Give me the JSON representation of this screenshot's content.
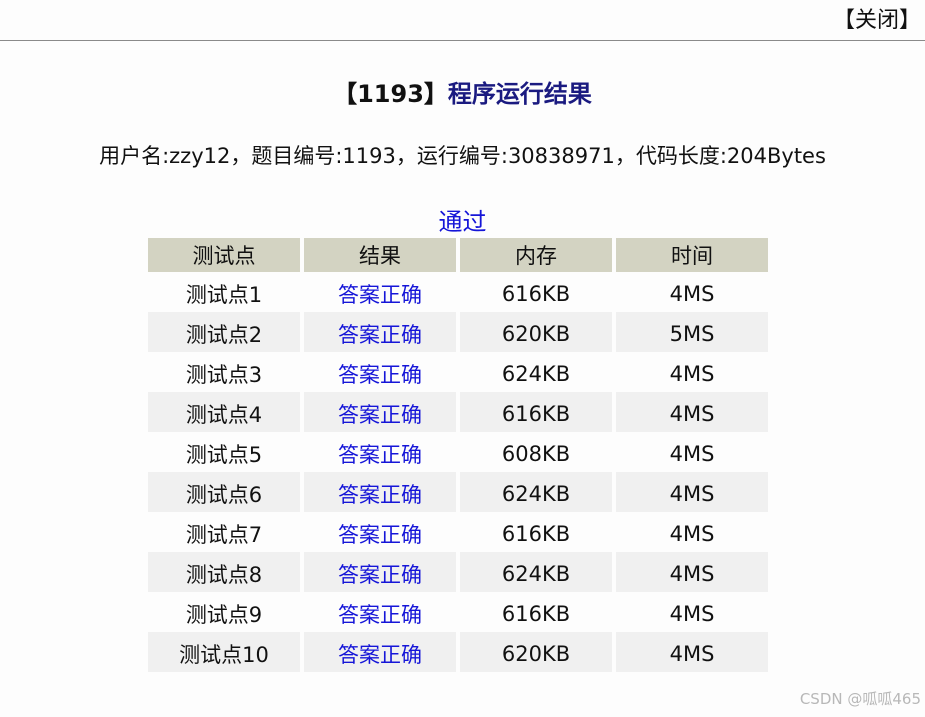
{
  "header": {
    "close_label": "【关闭】"
  },
  "title": {
    "problem_tag": "【1193】",
    "text": "程序运行结果"
  },
  "info_line": "用户名:zzy12，题目编号:1193，运行编号:30838971，代码长度:204Bytes",
  "status": "通过",
  "table": {
    "headers": [
      "测试点",
      "结果",
      "内存",
      "时间"
    ],
    "rows": [
      {
        "point": "测试点1",
        "result": "答案正确",
        "memory": "616KB",
        "time": "4MS"
      },
      {
        "point": "测试点2",
        "result": "答案正确",
        "memory": "620KB",
        "time": "5MS"
      },
      {
        "point": "测试点3",
        "result": "答案正确",
        "memory": "624KB",
        "time": "4MS"
      },
      {
        "point": "测试点4",
        "result": "答案正确",
        "memory": "616KB",
        "time": "4MS"
      },
      {
        "point": "测试点5",
        "result": "答案正确",
        "memory": "608KB",
        "time": "4MS"
      },
      {
        "point": "测试点6",
        "result": "答案正确",
        "memory": "624KB",
        "time": "4MS"
      },
      {
        "point": "测试点7",
        "result": "答案正确",
        "memory": "616KB",
        "time": "4MS"
      },
      {
        "point": "测试点8",
        "result": "答案正确",
        "memory": "624KB",
        "time": "4MS"
      },
      {
        "point": "测试点9",
        "result": "答案正确",
        "memory": "616KB",
        "time": "4MS"
      },
      {
        "point": "测试点10",
        "result": "答案正确",
        "memory": "620KB",
        "time": "4MS"
      }
    ]
  },
  "watermark": "CSDN @呱呱465",
  "colors": {
    "link": "#1515d8",
    "header_bg": "#d3d3c2",
    "stripe": "#f0f0f0",
    "title": "#1a1a80"
  }
}
